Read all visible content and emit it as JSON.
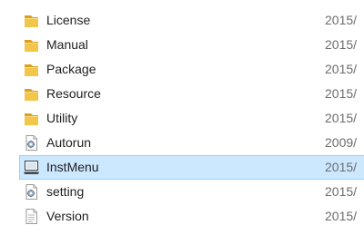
{
  "file_list": {
    "items": [
      {
        "name": "License",
        "date": "2015/",
        "icon": "folder-icon",
        "selected": false
      },
      {
        "name": "Manual",
        "date": "2015/",
        "icon": "folder-icon",
        "selected": false
      },
      {
        "name": "Package",
        "date": "2015/",
        "icon": "folder-icon",
        "selected": false
      },
      {
        "name": "Resource",
        "date": "2015/",
        "icon": "folder-icon",
        "selected": false
      },
      {
        "name": "Utility",
        "date": "2015/",
        "icon": "folder-icon",
        "selected": false
      },
      {
        "name": "Autorun",
        "date": "2009/",
        "icon": "settings-file-icon",
        "selected": false
      },
      {
        "name": "InstMenu",
        "date": "2015/",
        "icon": "application-icon",
        "selected": true
      },
      {
        "name": "setting",
        "date": "2015/",
        "icon": "settings-file-icon",
        "selected": false
      },
      {
        "name": "Version",
        "date": "2015/",
        "icon": "text-file-icon",
        "selected": false
      }
    ]
  },
  "colors": {
    "selection_fill": "#cce8ff",
    "selection_border": "#99d1ff",
    "folder": "#e8b641",
    "date_text": "#6d6d6d"
  }
}
